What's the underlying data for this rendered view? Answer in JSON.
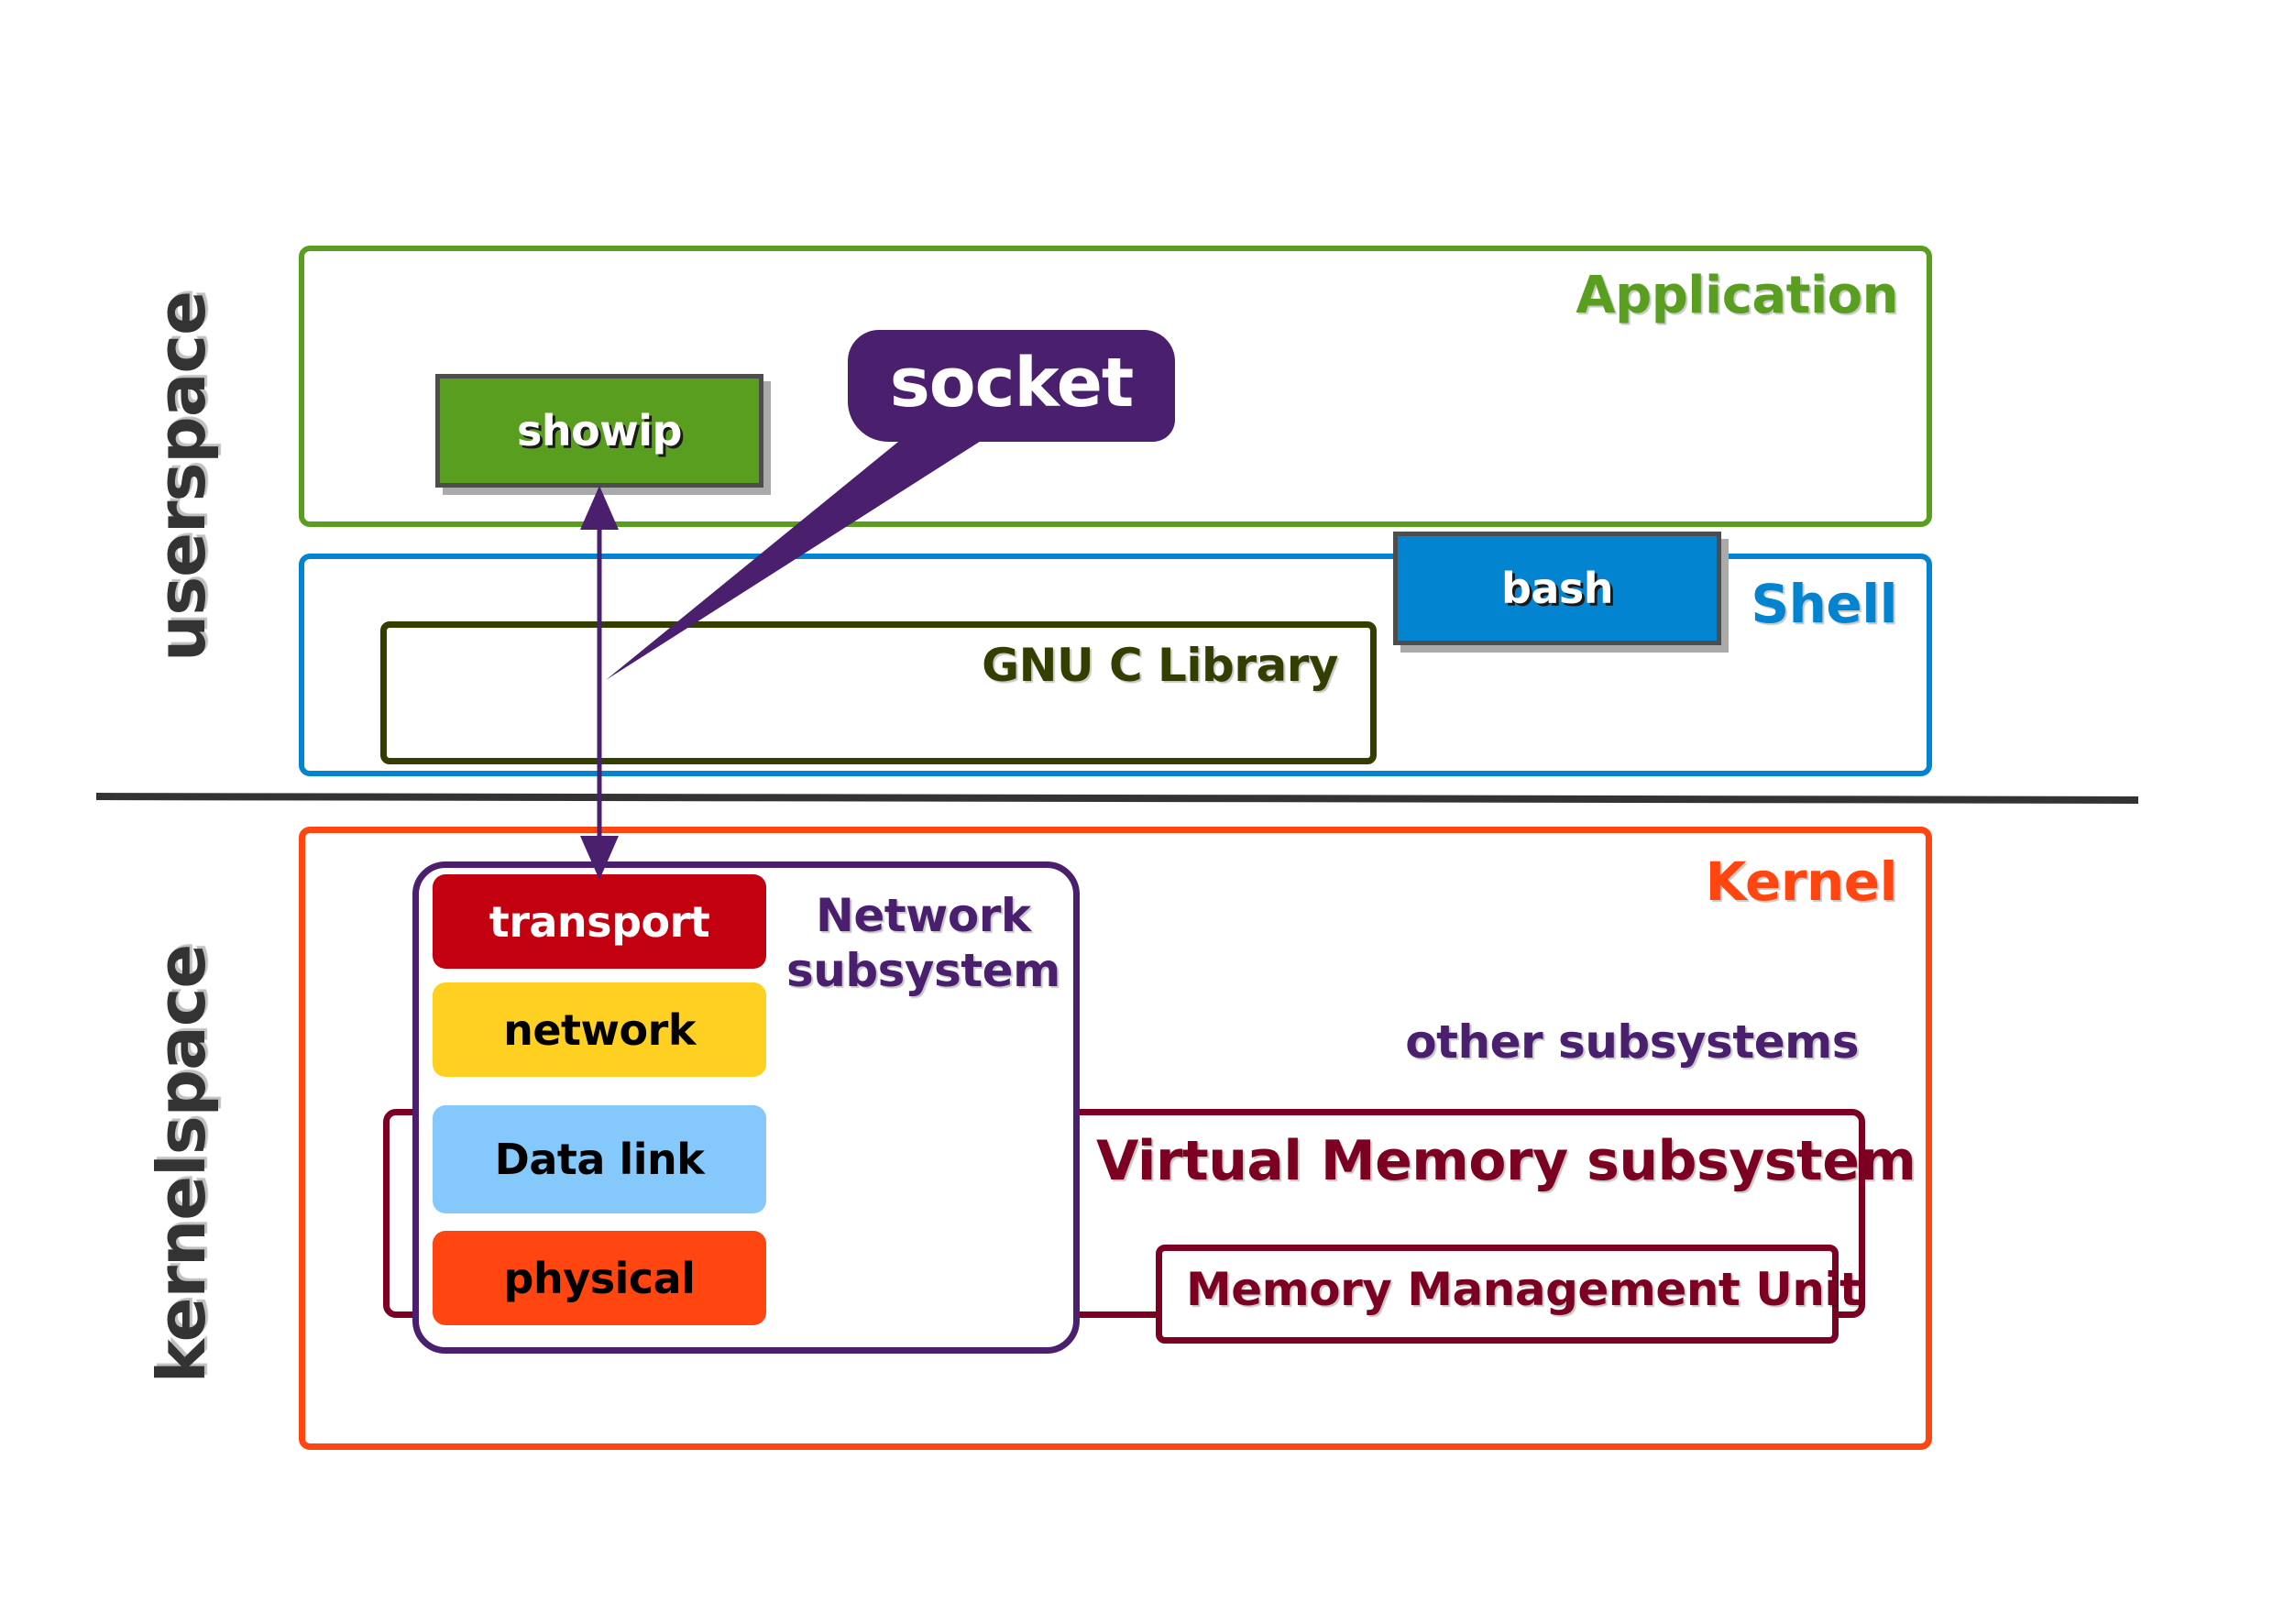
{
  "diagram": {
    "regions": {
      "userspace": "userspace",
      "kernelspace": "kernelspace"
    },
    "layers": {
      "application": {
        "label": "Application",
        "color": "#5a9e1f"
      },
      "shell": {
        "label": "Shell",
        "color": "#0284d0"
      },
      "kernel": {
        "label": "Kernel",
        "color": "#ff4611"
      }
    },
    "programs": {
      "showip": {
        "label": "showip",
        "color": "#5a9e1f"
      },
      "bash": {
        "label": "bash",
        "color": "#0284d0"
      }
    },
    "libraries": {
      "glibc": {
        "label": "GNU C Library",
        "color": "#333f00"
      }
    },
    "callout": {
      "label": "socket",
      "color": "#4a1f6e"
    },
    "network_subsystem": {
      "label_line1": "Network",
      "label_line2": "subsystem",
      "color": "#4a1f6e",
      "layers": [
        {
          "label": "transport",
          "fill": "#c3000f",
          "text_color": "#ffffff"
        },
        {
          "label": "network",
          "fill": "#fdd021",
          "text_color": "#000000"
        },
        {
          "label": "Data link",
          "fill": "#85c9fc",
          "text_color": "#000000"
        },
        {
          "label": "physical",
          "fill": "#ff4611",
          "text_color": "#000000"
        }
      ]
    },
    "other_subsystems": {
      "label": "other subsystems",
      "color": "#4a1f6e"
    },
    "virtual_memory": {
      "label": "Virtual Memory subsystem",
      "color": "#7b0022"
    },
    "mmu": {
      "label": "Memory Management Unit",
      "color": "#7b0022"
    },
    "divider_color": "#333333",
    "connector": {
      "from": "showip",
      "to": "transport",
      "bidirectional": true,
      "color": "#4a1f6e"
    }
  }
}
